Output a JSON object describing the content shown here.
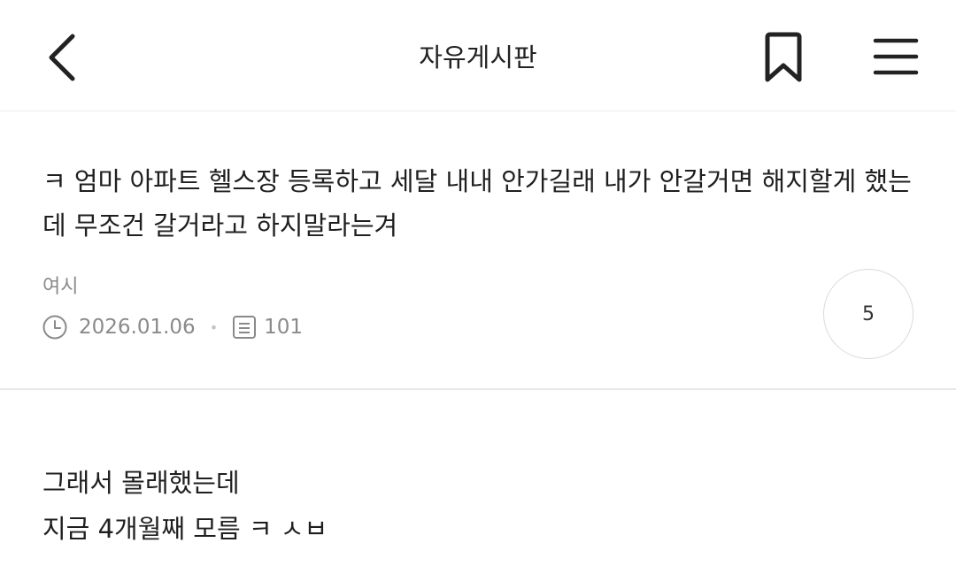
{
  "header": {
    "title": "자유게시판",
    "back_icon": "chevron-left-icon",
    "bookmark_icon": "bookmark-icon",
    "menu_icon": "hamburger-menu-icon"
  },
  "post": {
    "title": "ㅋ 엄마 아파트 헬스장 등록하고 세달 내내 안가길래 내가 안갈거면 해지할게 했는데 무조건 갈거라고 하지말라는겨",
    "author": "여시",
    "date": "2026.01.06",
    "views": "101",
    "comment_count": "5",
    "body_lines": [
      "그래서 몰래했는데",
      "지금 4개월째 모름 ㅋ ㅅㅂ"
    ]
  },
  "colors": {
    "text": "#1f1f1f",
    "meta": "#8a8a8a",
    "divider": "#e8e8e8"
  }
}
